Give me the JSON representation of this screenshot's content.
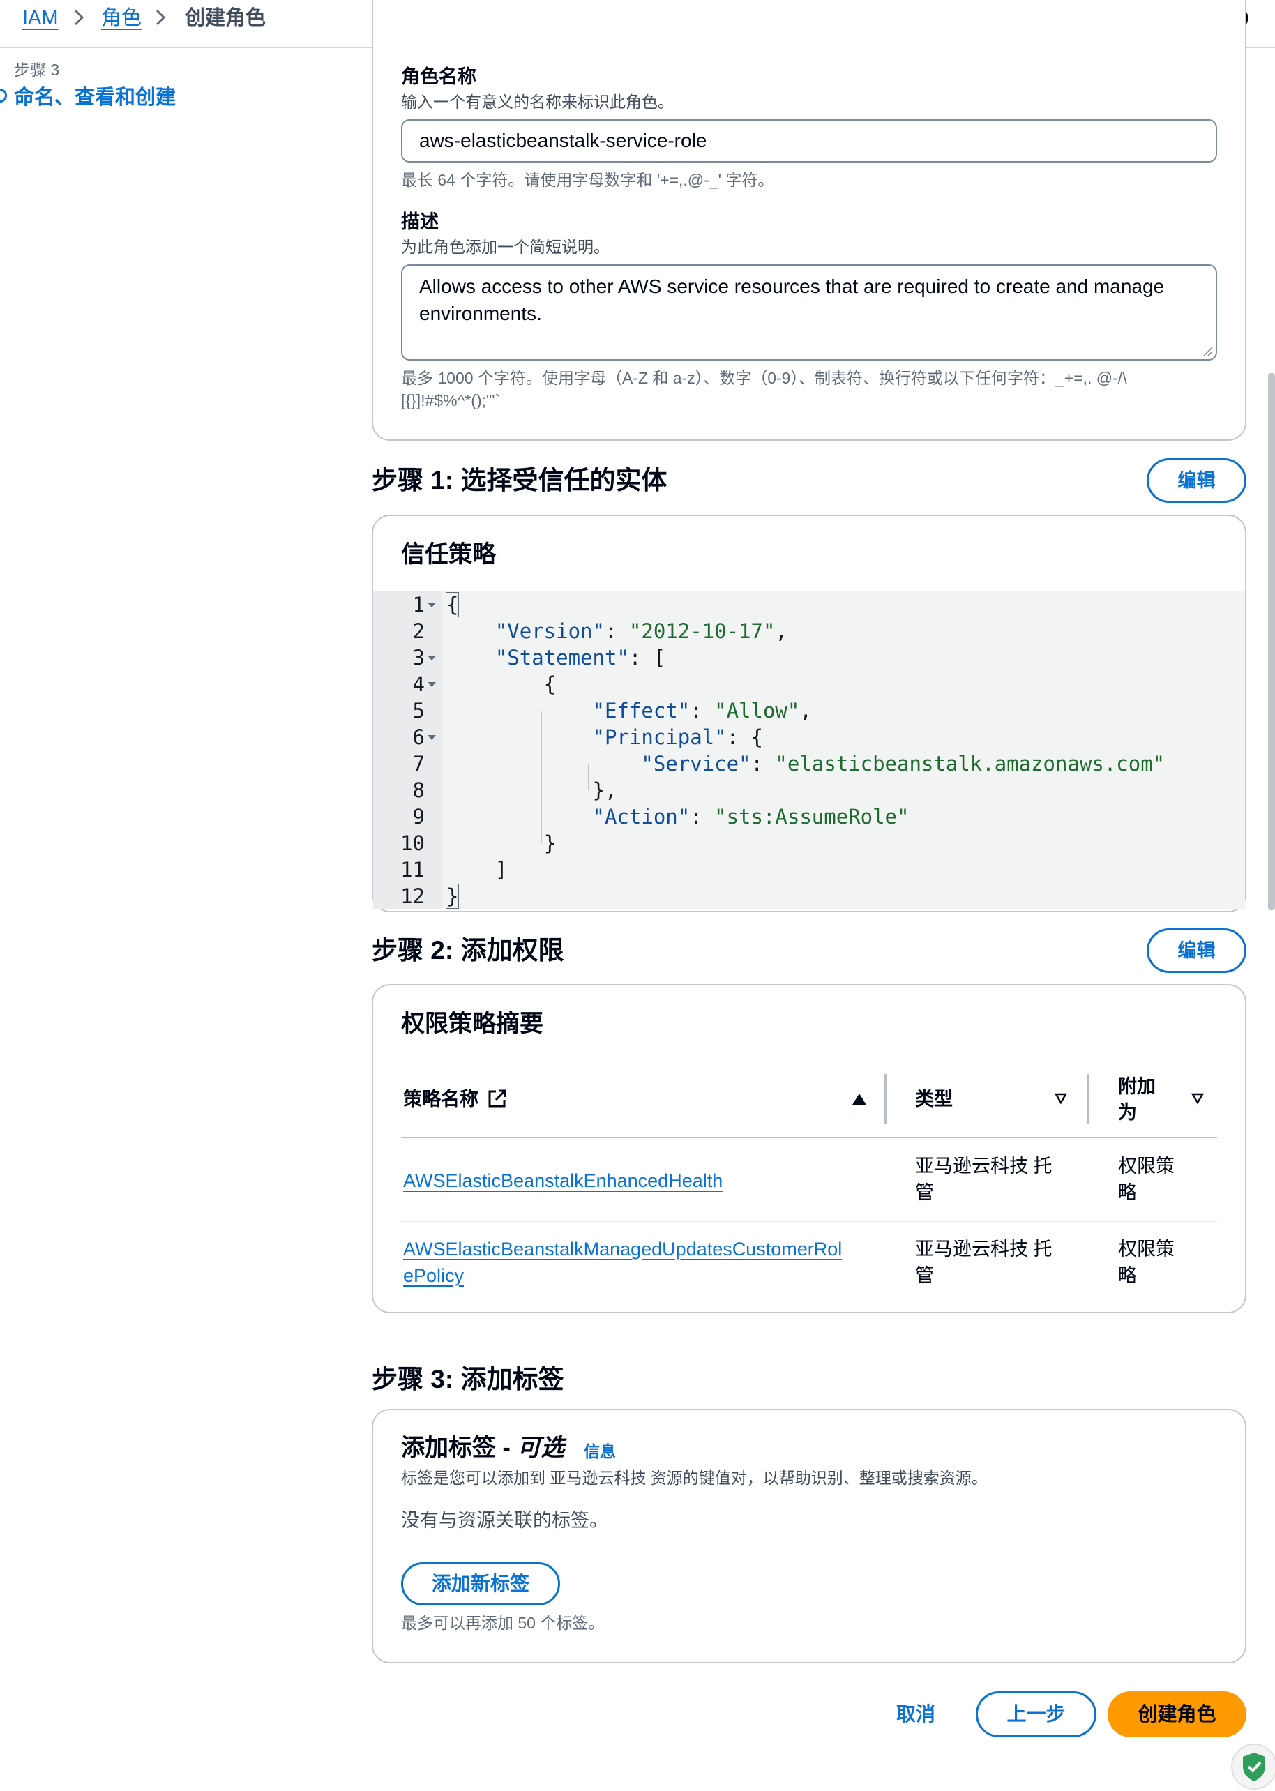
{
  "breadcrumb": {
    "root": "IAM",
    "parent": "角色",
    "current": "创建角色"
  },
  "sidebar": {
    "step_number": "步骤 3",
    "step_title": "命名、查看和创建"
  },
  "role_details": {
    "name_label": "角色名称",
    "name_description": "输入一个有意义的名称来标识此角色。",
    "name_value": "aws-elasticbeanstalk-service-role",
    "name_hint": "最长 64 个字符。请使用字母数字和 '+=,.@-_' 字符。",
    "desc_label": "描述",
    "desc_description": "为此角色添加一个简短说明。",
    "desc_value_line1": "Allows access to other AWS service resources that are required to create and manage",
    "desc_value_line2": "environments.",
    "desc_hint_line1": "最多 1000 个字符。使用字母（A-Z 和 a-z）、数字（0-9）、制表符、换行符或以下任何字符：_+=,. @-/\\",
    "desc_hint_line2": "[{}]!#$%^*();\"'`"
  },
  "step1": {
    "title": "步骤 1: 选择受信任的实体",
    "edit_label": "编辑",
    "panel_title": "信任策略",
    "line_numbers": [
      "1",
      "2",
      "3",
      "4",
      "5",
      "6",
      "7",
      "8",
      "9",
      "10",
      "11",
      "12"
    ],
    "code": {
      "l1": "{",
      "l2_key": "\"Version\"",
      "l2_val": "\"2012-10-17\"",
      "l3_key": "\"Statement\"",
      "l3_rest": ": [",
      "l4": "{",
      "l5_key": "\"Effect\"",
      "l5_val": "\"Allow\"",
      "l6_key": "\"Principal\"",
      "l6_rest": ": {",
      "l7_key": "\"Service\"",
      "l7_val": "\"elasticbeanstalk.amazonaws.com\"",
      "l8": "},",
      "l9_key": "\"Action\"",
      "l9_val": "\"sts:AssumeRole\"",
      "l10": "}",
      "l11": "]",
      "l12": "}"
    }
  },
  "step2": {
    "title": "步骤 2: 添加权限",
    "edit_label": "编辑",
    "panel_title": "权限策略摘要",
    "columns": {
      "name": "策略名称",
      "type": "类型",
      "attached_line1": "附加",
      "attached_line2": "为"
    },
    "rows": [
      {
        "name_line1": "AWSElasticBeanstalkEnhancedHealth",
        "name_line2": "",
        "type_line1": "亚马逊云科技 托",
        "type_line2": "管",
        "attached_line1": "权限策",
        "attached_line2": "略"
      },
      {
        "name_line1": "AWSElasticBeanstalkManagedUpdatesCustomerRol",
        "name_line2": "ePolicy",
        "type_line1": "亚马逊云科技 托",
        "type_line2": "管",
        "attached_line1": "权限策",
        "attached_line2": "略"
      }
    ]
  },
  "step3": {
    "title": "步骤 3: 添加标签",
    "panel_title": "添加标签 - ",
    "panel_title_optional": "可选",
    "info_link": "信息",
    "description": "标签是您可以添加到 亚马逊云科技 资源的键值对，以帮助识别、整理或搜索资源。",
    "empty_text": "没有与资源关联的标签。",
    "add_button": "添加新标签",
    "limit_text": "最多可以再添加 50 个标签。"
  },
  "footer": {
    "cancel": "取消",
    "previous": "上一步",
    "create": "创建角色"
  },
  "colors": {
    "link": "#0972d3",
    "primary_button": "#ff9900",
    "border": "#c6c6cd",
    "code_string": "#1d6b2f",
    "code_key": "#0f4c99"
  }
}
